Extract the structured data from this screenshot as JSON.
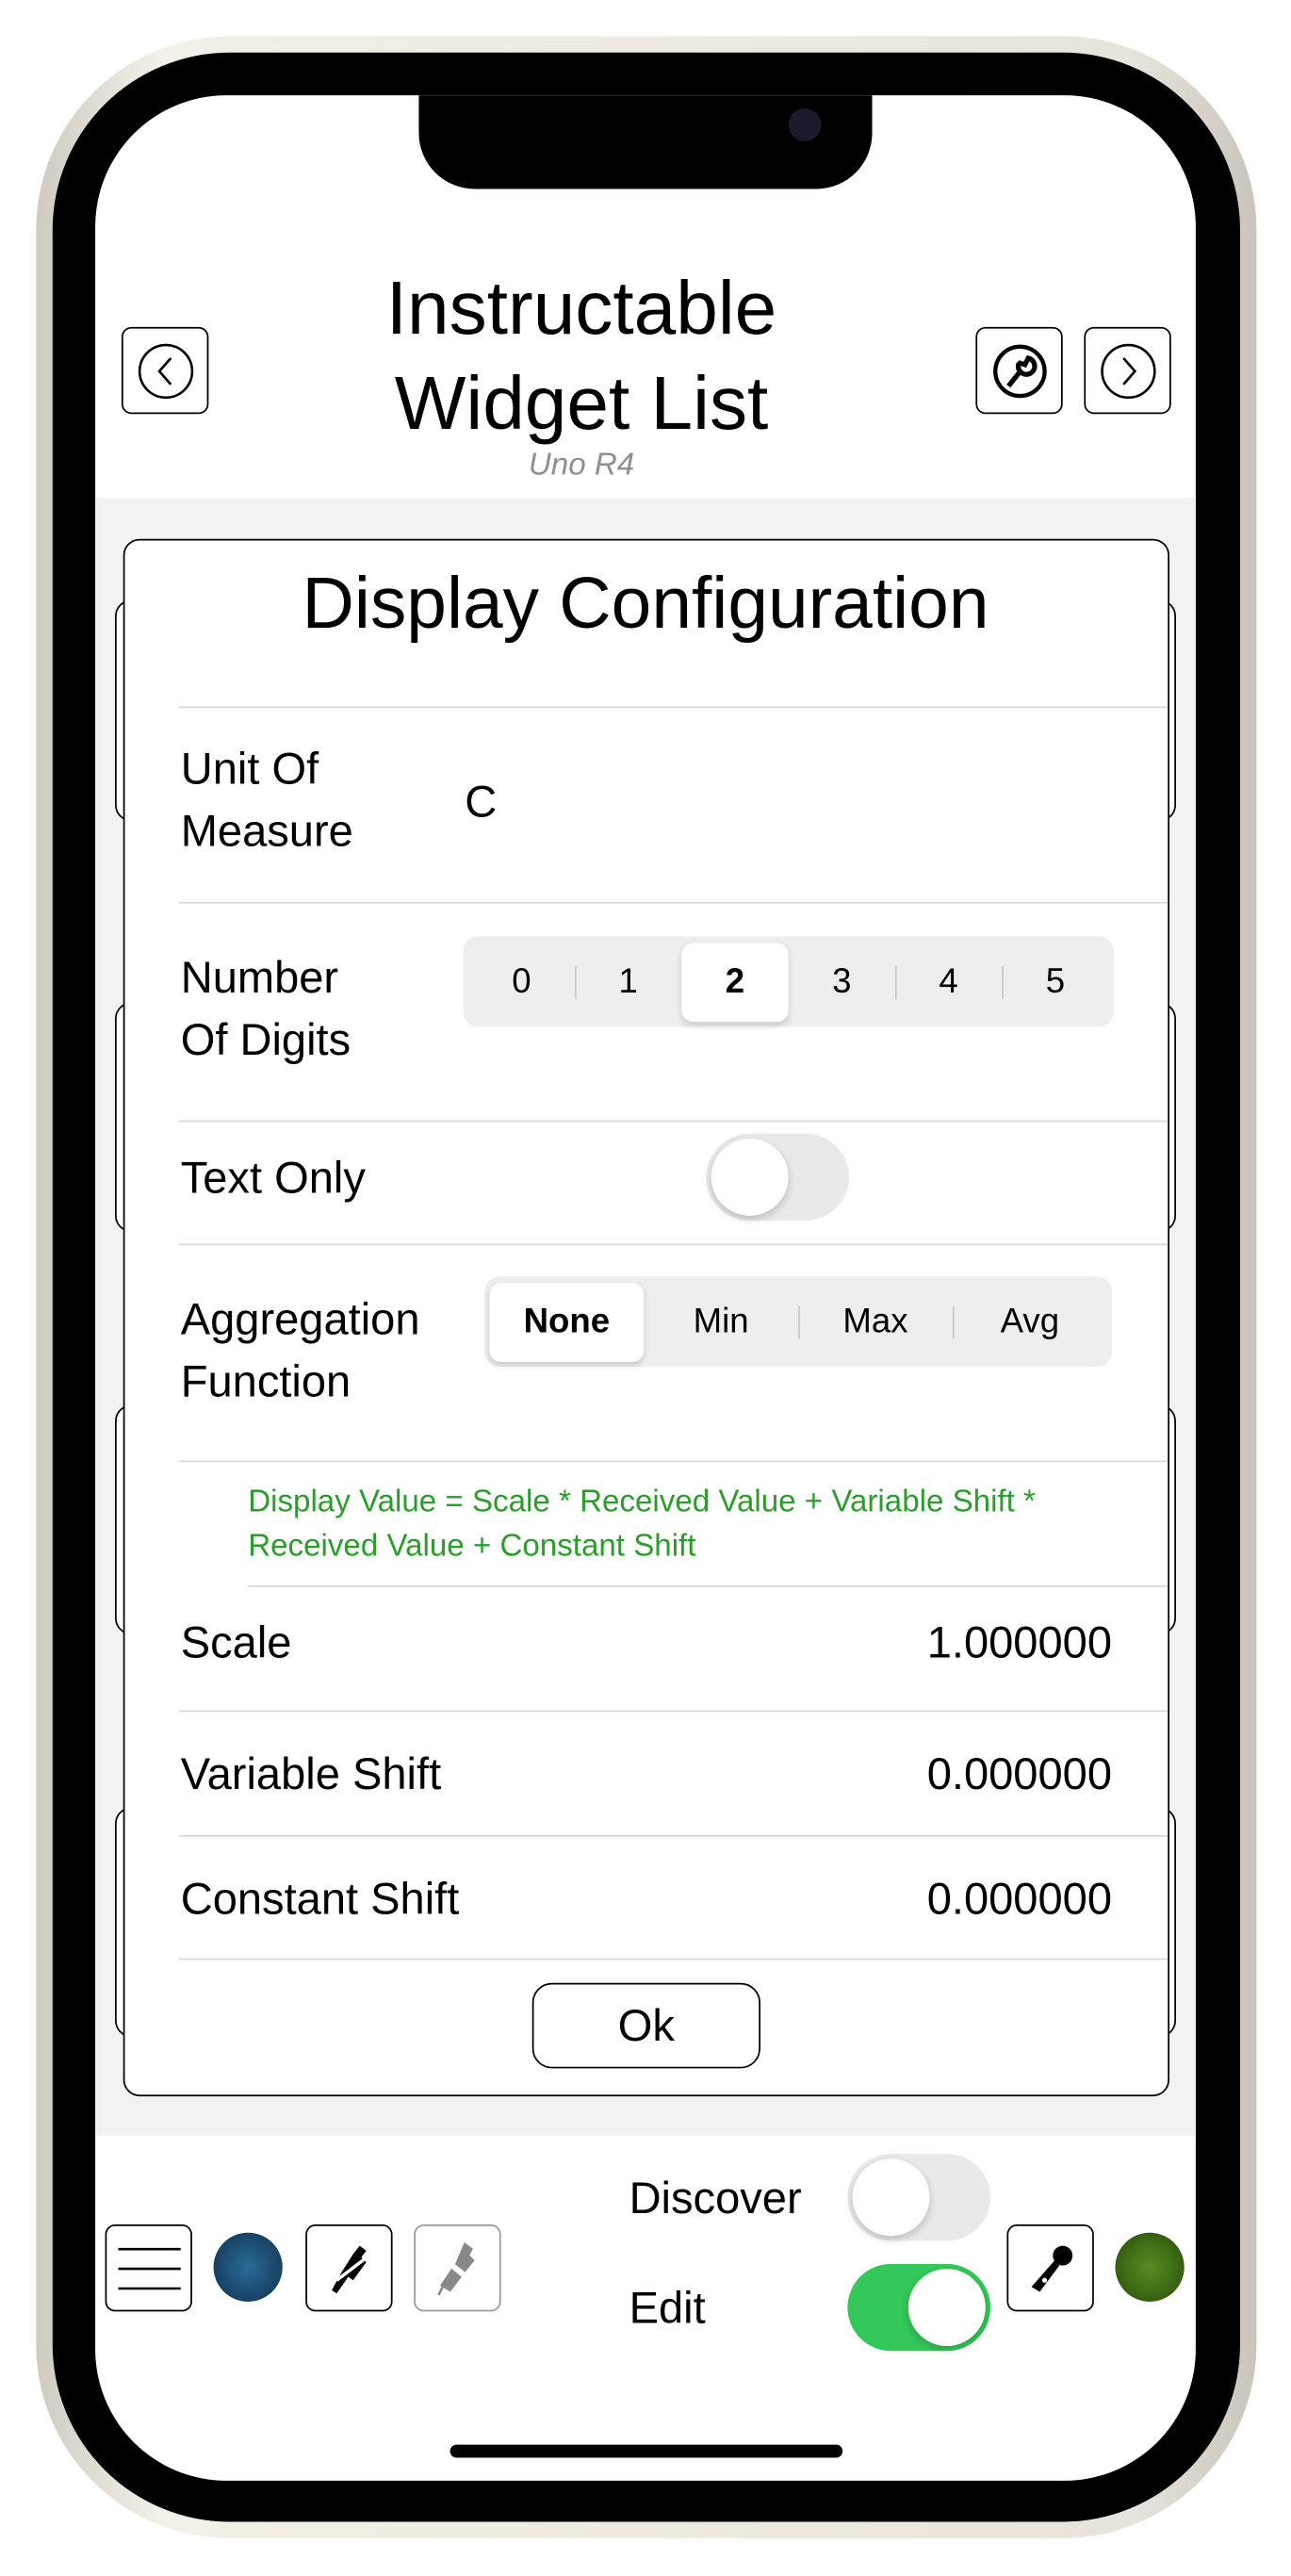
{
  "header": {
    "title_line1": "Instructable",
    "title_line2": "Widget List",
    "subtitle": "Uno R4"
  },
  "dialog": {
    "title": "Display Configuration",
    "unit": {
      "label_line1": "Unit Of",
      "label_line2": "Measure",
      "value": "C"
    },
    "digits": {
      "label_line1": "Number",
      "label_line2": "Of Digits",
      "options": [
        "0",
        "1",
        "2",
        "3",
        "4",
        "5"
      ],
      "selected": "2"
    },
    "text_only": {
      "label": "Text Only",
      "on": false
    },
    "aggregation": {
      "label_line1": "Aggregation",
      "label_line2": "Function",
      "options": [
        "None",
        "Min",
        "Max",
        "Avg"
      ],
      "selected": "None"
    },
    "formula": "Display Value = Scale * Received Value + Variable Shift * Received Value + Constant Shift",
    "scale": {
      "label": "Scale",
      "value": "1.000000"
    },
    "variable_shift": {
      "label": "Variable Shift",
      "value": "0.000000"
    },
    "constant_shift": {
      "label": "Constant Shift",
      "value": "0.000000"
    },
    "ok_label": "Ok"
  },
  "bottom": {
    "discover_label": "Discover",
    "discover_on": false,
    "edit_label": "Edit",
    "edit_on": true,
    "connection_led_color": "#1b4a6e",
    "status_led_color": "#3d6a14",
    "toggle_on_color": "#34c759"
  }
}
